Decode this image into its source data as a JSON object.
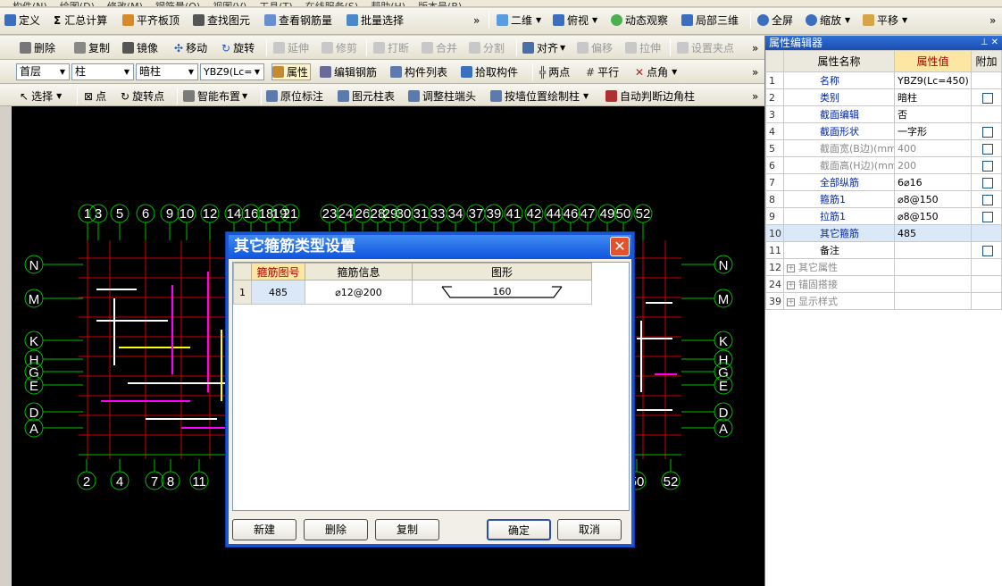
{
  "menubar": [
    "构件(N)",
    "绘图(D)",
    "修改(M)",
    "钢筋量(Q)",
    "视图(V)",
    "工具(T)",
    "在线服务(S)",
    "帮助(H)",
    "版本号(B)"
  ],
  "toolbar1": {
    "define": "定义",
    "sum": "汇总计算",
    "floor_top": "平齐板顶",
    "find": "查找图元",
    "view_rebar": "查看钢筋量",
    "batch_select": "批量选择",
    "view_2d": "二维",
    "top_view": "俯视",
    "dynamic_view": "动态观察",
    "local_3d": "局部三维",
    "fullscreen": "全屏",
    "zoom": "缩放",
    "pan": "平移"
  },
  "toolbar2": {
    "delete": "删除",
    "copy": "复制",
    "mirror": "镜像",
    "move": "移动",
    "rotate": "旋转",
    "extend": "延伸",
    "trim": "修剪",
    "break": "打断",
    "merge": "合并",
    "split": "分割",
    "align": "对齐",
    "offset": "偏移",
    "stretch": "拉伸",
    "set_grip": "设置夹点"
  },
  "toolbar3": {
    "floor": "首层",
    "category": "柱",
    "type": "暗柱",
    "component": "YBZ9(Lc=",
    "attribute": "属性",
    "edit_rebar": "编辑钢筋",
    "component_list": "构件列表",
    "pick": "拾取构件",
    "two_point": "两点",
    "parallel": "平行",
    "point_angle": "点角"
  },
  "toolbar4": {
    "select": "选择",
    "point": "点",
    "rotate_point": "旋转点",
    "smart_layout": "智能布置",
    "in_place": "原位标注",
    "column_table": "图元柱表",
    "adjust_head": "调整柱端头",
    "wall_draw": "按墙位置绘制柱",
    "auto_corner": "自动判断边角柱"
  },
  "canvas": {
    "top_axes": [
      "1",
      "3",
      "5",
      "6",
      "9",
      "10",
      "12",
      "14",
      "16",
      "18",
      "19",
      "21",
      "23",
      "24",
      "26",
      "28",
      "29",
      "30",
      "31",
      "33",
      "34",
      "37",
      "39",
      "41",
      "42",
      "44",
      "46",
      "47",
      "49",
      "50",
      "52"
    ],
    "bottom_axes": [
      "2",
      "4",
      "7",
      "8",
      "11",
      "50",
      "52"
    ],
    "left_axes": [
      "N",
      "M",
      "K",
      "H",
      "G",
      "E",
      "D",
      "A"
    ],
    "right_axes": [
      "N",
      "M",
      "K",
      "H",
      "G",
      "E",
      "D",
      "A"
    ]
  },
  "property_panel": {
    "title": "属性编辑器",
    "headers": {
      "name": "属性名称",
      "value": "属性值",
      "attach": "附加"
    },
    "rows": [
      {
        "n": "1",
        "name": "名称",
        "value": "YBZ9(Lc=450)",
        "check": false,
        "style": "blue"
      },
      {
        "n": "2",
        "name": "类别",
        "value": "暗柱",
        "check": true,
        "style": "blue"
      },
      {
        "n": "3",
        "name": "截面编辑",
        "value": "否",
        "check": false,
        "style": "blue"
      },
      {
        "n": "4",
        "name": "截面形状",
        "value": "一字形",
        "check": true,
        "style": "blue"
      },
      {
        "n": "5",
        "name": "截面宽(B边)(mm)",
        "value": "400",
        "check": true,
        "style": "gray"
      },
      {
        "n": "6",
        "name": "截面高(H边)(mm)",
        "value": "200",
        "check": true,
        "style": "gray"
      },
      {
        "n": "7",
        "name": "全部纵筋",
        "value": "6⌀16",
        "check": true,
        "style": "blue"
      },
      {
        "n": "8",
        "name": "箍筋1",
        "value": "⌀8@150",
        "check": true,
        "style": "blue"
      },
      {
        "n": "9",
        "name": "拉筋1",
        "value": "⌀8@150",
        "check": true,
        "style": "blue"
      },
      {
        "n": "10",
        "name": "其它箍筋",
        "value": "485",
        "check": false,
        "style": "blue"
      },
      {
        "n": "11",
        "name": "备注",
        "value": "",
        "check": true,
        "style": "plain"
      },
      {
        "n": "12",
        "name": "其它属性",
        "value": "",
        "check": false,
        "style": "group"
      },
      {
        "n": "24",
        "name": "锚固搭接",
        "value": "",
        "check": false,
        "style": "group"
      },
      {
        "n": "39",
        "name": "显示样式",
        "value": "",
        "check": false,
        "style": "group"
      }
    ]
  },
  "dialog": {
    "title": "其它箍筋类型设置",
    "headers": {
      "shape_no": "箍筋图号",
      "info": "箍筋信息",
      "shape": "图形"
    },
    "rows": [
      {
        "n": "1",
        "shape_no": "485",
        "info": "⌀12@200",
        "dim": "160"
      }
    ],
    "buttons": {
      "new": "新建",
      "delete": "删除",
      "copy": "复制",
      "ok": "确定",
      "cancel": "取消"
    }
  }
}
